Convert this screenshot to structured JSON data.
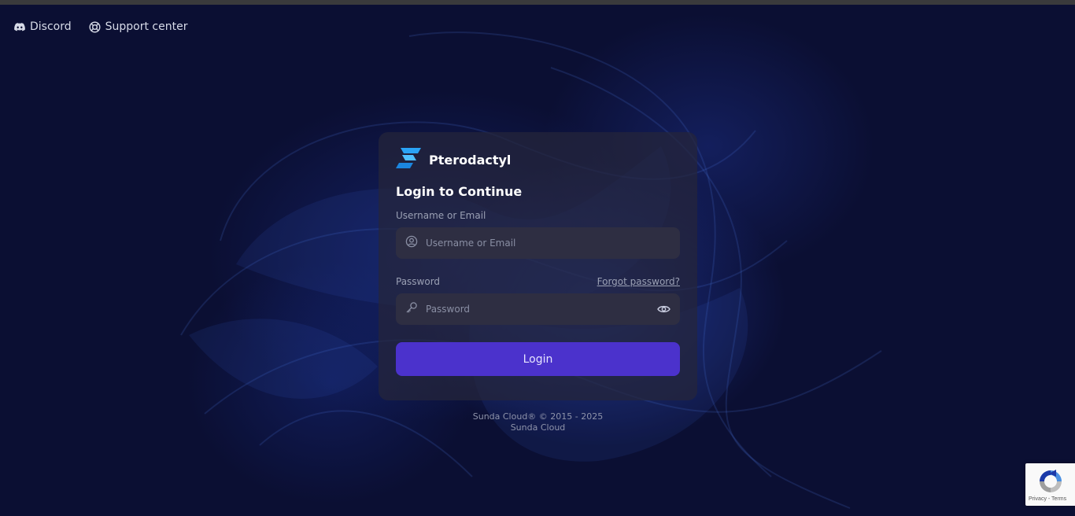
{
  "topnav": {
    "discord_label": "Discord",
    "support_label": "Support center"
  },
  "card": {
    "brand_name": "Pterodactyl",
    "heading": "Login to Continue",
    "username_label": "Username or Email",
    "username_placeholder": "Username or Email",
    "username_value": "",
    "password_label": "Password",
    "forgot_label": "Forgot password?",
    "password_placeholder": "Password",
    "password_value": "",
    "login_label": "Login"
  },
  "footer": {
    "line1": "Sunda Cloud® © 2015 - 2025",
    "line2": "Sunda Cloud"
  },
  "recaptcha": {
    "terms_text": "Privacy - Terms"
  },
  "colors": {
    "accent": "#4b32cc",
    "brand_logo": "#2aa3f5",
    "background": "#0b0f33"
  }
}
